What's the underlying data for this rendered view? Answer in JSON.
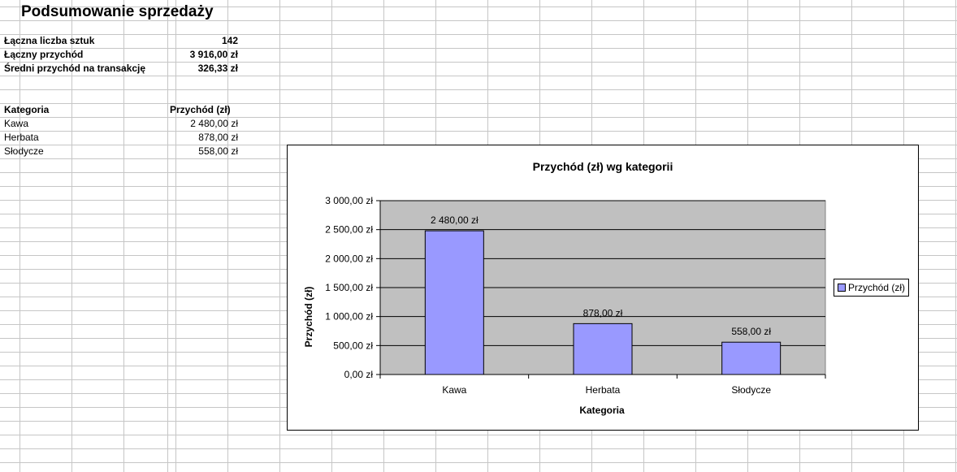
{
  "title": "Podsumowanie sprzedaży",
  "summary": {
    "rows": [
      {
        "label": "Łączna liczba sztuk",
        "value": "142"
      },
      {
        "label": "Łączny przychód",
        "value": "3 916,00 zł"
      },
      {
        "label": "Średni przychód na transakcję",
        "value": "326,33 zł"
      }
    ]
  },
  "table": {
    "headers": [
      "Kategoria",
      "Przychód (zł)"
    ],
    "rows": [
      {
        "category": "Kawa",
        "revenue": "2 480,00 zł"
      },
      {
        "category": "Herbata",
        "revenue": "878,00 zł"
      },
      {
        "category": "Słodycze",
        "revenue": "558,00 zł"
      }
    ]
  },
  "colors": {
    "bar": "#9999ff",
    "plot_bg": "#c0c0c0",
    "grid": "#000000"
  },
  "chart_data": {
    "type": "bar",
    "title": "Przychód (zł) wg kategorii",
    "xlabel": "Kategoria",
    "ylabel": "Przychód (zł)",
    "categories": [
      "Kawa",
      "Herbata",
      "Słodycze"
    ],
    "series": [
      {
        "name": "Przychód (zł)",
        "values": [
          2480,
          878,
          558
        ]
      }
    ],
    "data_labels": [
      "2 480,00 zł",
      "878,00 zł",
      "558,00 zł"
    ],
    "ylim": [
      0,
      3000
    ],
    "yticks": [
      0,
      500,
      1000,
      1500,
      2000,
      2500,
      3000
    ],
    "ytick_labels": [
      "0,00 zł",
      "500,00 zł",
      "1 000,00 zł",
      "1 500,00 zł",
      "2 000,00 zł",
      "2 500,00 zł",
      "3 000,00 zł"
    ],
    "grid": true,
    "legend": "right"
  }
}
